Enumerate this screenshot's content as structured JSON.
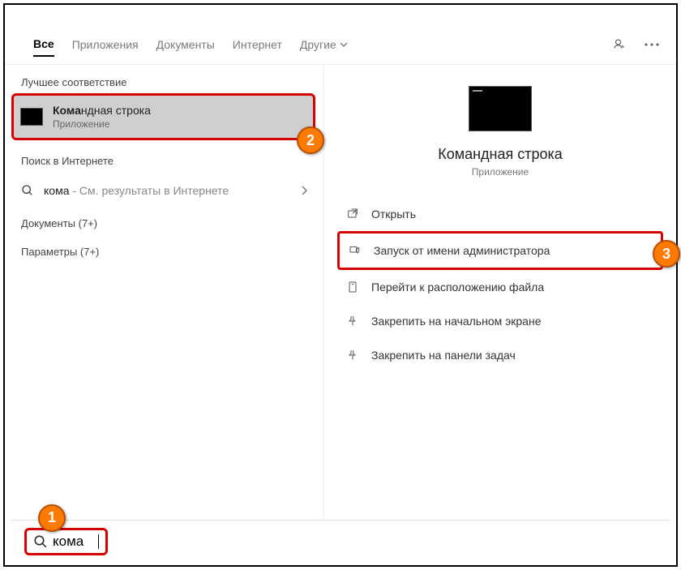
{
  "tabs": {
    "all": "Все",
    "apps": "Приложения",
    "docs": "Документы",
    "internet": "Интернет",
    "other": "Другие"
  },
  "sections": {
    "best_match": "Лучшее соответствие",
    "web_search": "Поиск в Интернете",
    "documents": "Документы (7+)",
    "parameters": "Параметры (7+)"
  },
  "best": {
    "title_bold": "Кома",
    "title_rest": "ндная строка",
    "subtitle": "Приложение"
  },
  "websearch": {
    "query": "кома",
    "suffix": " - См. результаты в Интернете"
  },
  "preview": {
    "title": "Командная строка",
    "subtitle": "Приложение"
  },
  "actions": {
    "open": "Открыть",
    "runas": "Запуск от имени администратора",
    "openloc": "Перейти к расположению файла",
    "pinstart": "Закрепить на начальном экране",
    "pintask": "Закрепить на панели задач"
  },
  "search": {
    "value": "кома"
  },
  "badges": {
    "b1": "1",
    "b2": "2",
    "b3": "3"
  }
}
